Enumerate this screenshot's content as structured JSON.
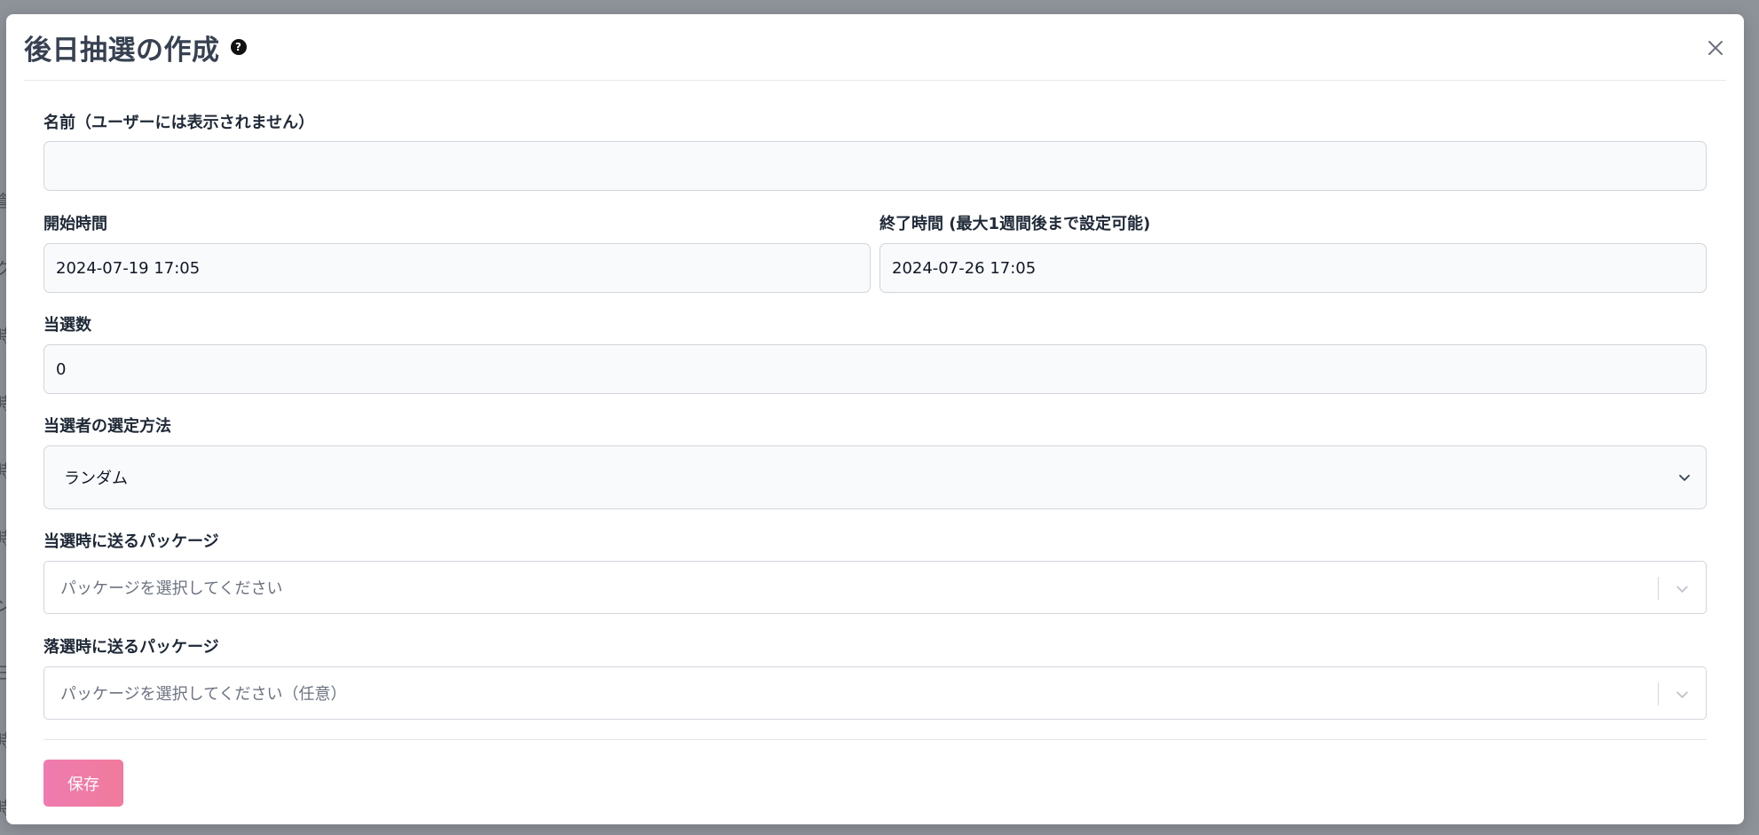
{
  "background": {
    "chars": [
      "倉",
      "ク",
      "時",
      "時",
      "時",
      "時",
      "ン",
      "日",
      "時",
      "時"
    ]
  },
  "modal": {
    "title": "後日抽選の作成",
    "help_icon": "question-circle-icon",
    "close_icon": "close-icon"
  },
  "form": {
    "name": {
      "label": "名前（ユーザーには表示されません）",
      "value": ""
    },
    "start_time": {
      "label": "開始時間",
      "value": "2024-07-19 17:05"
    },
    "end_time": {
      "label": "終了時間 (最大1週間後まで設定可能)",
      "value": "2024-07-26 17:05"
    },
    "winner_count": {
      "label": "当選数",
      "value": "0"
    },
    "selection_method": {
      "label": "当選者の選定方法",
      "selected": "ランダム"
    },
    "win_package": {
      "label": "当選時に送るパッケージ",
      "placeholder": "パッケージを選択してください"
    },
    "lose_package": {
      "label": "落選時に送るパッケージ",
      "placeholder": "パッケージを選択してください（任意）"
    }
  },
  "footer": {
    "save_label": "保存"
  },
  "colors": {
    "save_button": "#f07ba6",
    "overlay": "#8e9299",
    "title": "#374151"
  }
}
